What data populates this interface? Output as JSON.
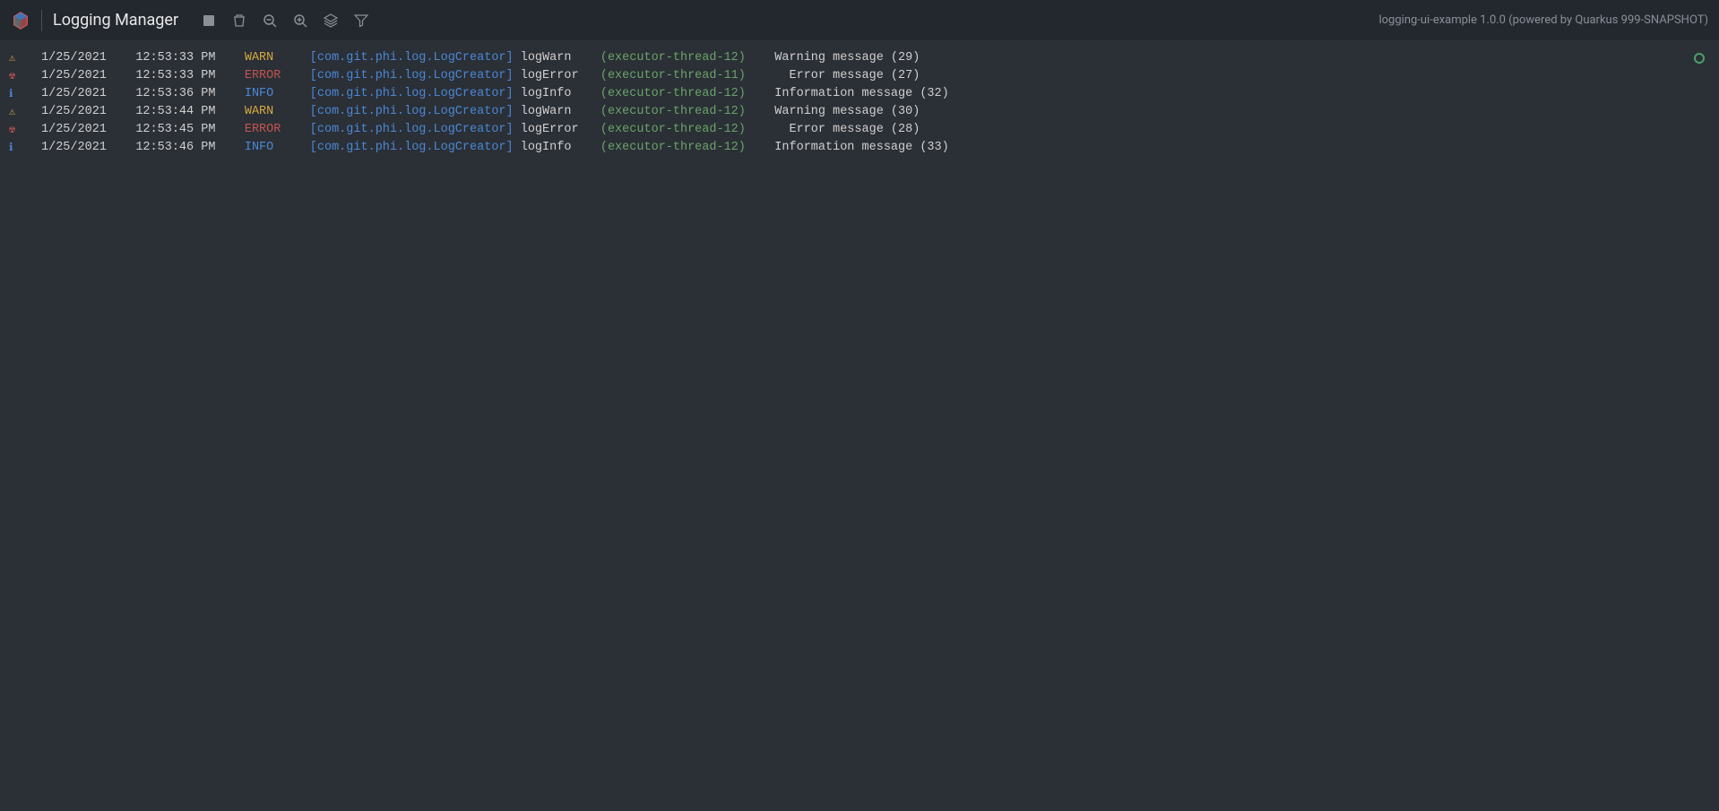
{
  "header": {
    "title": "Logging Manager",
    "status": "logging-ui-example 1.0.0 (powered by Quarkus 999-SNAPSHOT)"
  },
  "toolbar": {
    "stop": "stop",
    "trash": "trash",
    "zoom_out": "zoom-out",
    "zoom_in": "zoom-in",
    "layers": "layers",
    "filter": "filter"
  },
  "colors": {
    "warn": "#d4a940",
    "error": "#c25450",
    "info": "#4a88d4",
    "thread": "#6aa36a",
    "bg": "#2b2f36"
  },
  "logs": [
    {
      "icon": "⚠",
      "iconColor": "#d4a940",
      "date": "1/25/2021",
      "time": "12:53:33 PM",
      "level": "WARN",
      "source": "[com.git.phi.log.LogCreator]",
      "method": "logWarn",
      "thread": "(executor-thread-12)",
      "message": "Warning message (29)"
    },
    {
      "icon": "☢",
      "iconColor": "#c25450",
      "date": "1/25/2021",
      "time": "12:53:33 PM",
      "level": "ERROR",
      "source": "[com.git.phi.log.LogCreator]",
      "method": "logError",
      "thread": "(executor-thread-11)",
      "message": "  Error message (27)"
    },
    {
      "icon": "ℹ",
      "iconColor": "#4a88d4",
      "date": "1/25/2021",
      "time": "12:53:36 PM",
      "level": "INFO",
      "source": "[com.git.phi.log.LogCreator]",
      "method": "logInfo",
      "thread": "(executor-thread-12)",
      "message": "Information message (32)"
    },
    {
      "icon": "⚠",
      "iconColor": "#d4a940",
      "date": "1/25/2021",
      "time": "12:53:44 PM",
      "level": "WARN",
      "source": "[com.git.phi.log.LogCreator]",
      "method": "logWarn",
      "thread": "(executor-thread-12)",
      "message": "Warning message (30)"
    },
    {
      "icon": "☢",
      "iconColor": "#c25450",
      "date": "1/25/2021",
      "time": "12:53:45 PM",
      "level": "ERROR",
      "source": "[com.git.phi.log.LogCreator]",
      "method": "logError",
      "thread": "(executor-thread-12)",
      "message": "  Error message (28)"
    },
    {
      "icon": "ℹ",
      "iconColor": "#4a88d4",
      "date": "1/25/2021",
      "time": "12:53:46 PM",
      "level": "INFO",
      "source": "[com.git.phi.log.LogCreator]",
      "method": "logInfo",
      "thread": "(executor-thread-12)",
      "message": "Information message (33)"
    }
  ]
}
